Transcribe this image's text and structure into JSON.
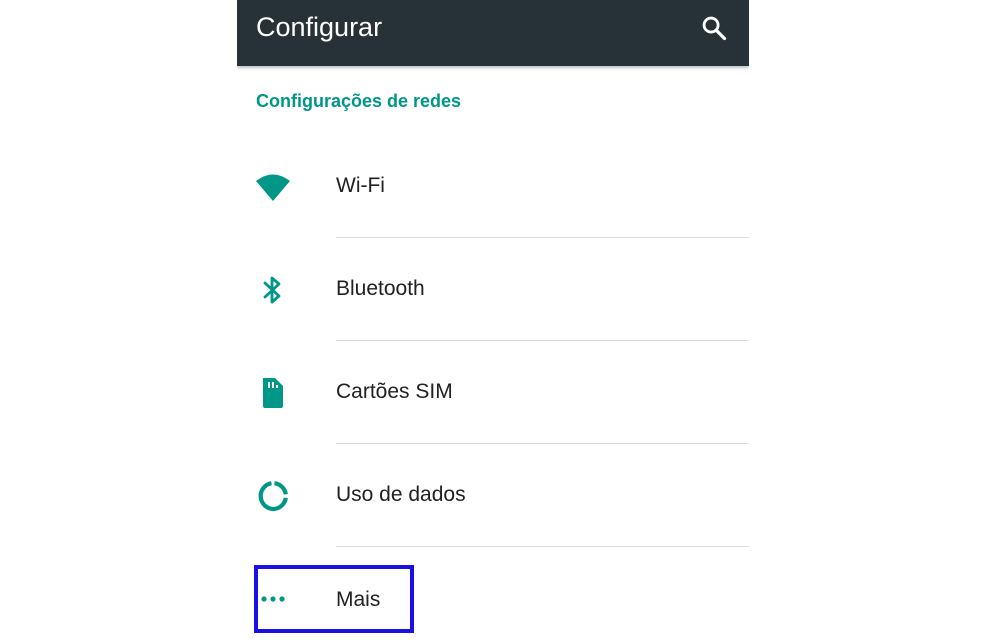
{
  "appbar": {
    "title": "Configurar",
    "search_icon": "search-icon"
  },
  "section": {
    "header": "Configurações de redes"
  },
  "items": [
    {
      "label": "Wi-Fi",
      "icon": "wifi-icon"
    },
    {
      "label": "Bluetooth",
      "icon": "bluetooth-icon"
    },
    {
      "label": "Cartões SIM",
      "icon": "sim-card-icon"
    },
    {
      "label": "Uso de dados",
      "icon": "data-usage-icon"
    },
    {
      "label": "Mais",
      "icon": "more-horiz-icon"
    }
  ],
  "colors": {
    "appbar": "#263238",
    "accent": "#009688",
    "highlight": "#1a10e6",
    "text": "#212121"
  }
}
